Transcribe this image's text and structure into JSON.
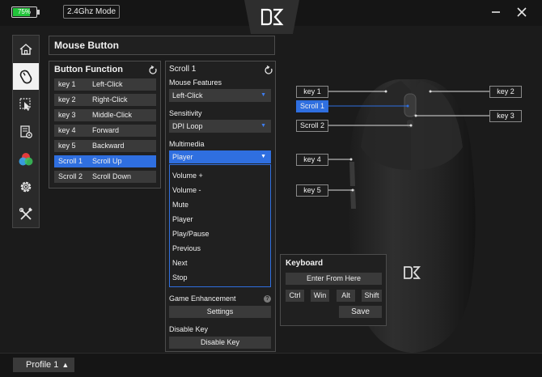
{
  "topbar": {
    "battery_percent": "75%",
    "battery_level": 0.75,
    "battery_color": "#22c43a",
    "connection_mode": "2.4Ghz Mode",
    "logo_icon": "dz-logo-icon",
    "minimize_icon": "minimize-icon",
    "close_icon": "close-icon"
  },
  "sidebar": {
    "items": [
      {
        "icon": "home-icon",
        "active": false
      },
      {
        "icon": "mouse-icon",
        "active": true
      },
      {
        "icon": "pointer-settings-icon",
        "active": false
      },
      {
        "icon": "macro-icon",
        "active": false
      },
      {
        "icon": "rgb-lighting-icon",
        "active": false
      },
      {
        "icon": "gear-icon",
        "active": false
      },
      {
        "icon": "tools-icon",
        "active": false
      }
    ]
  },
  "page_title": "Mouse Button",
  "button_function": {
    "title": "Button Function",
    "rows": [
      {
        "key": "key 1",
        "value": "Left-Click"
      },
      {
        "key": "key 2",
        "value": "Right-Click"
      },
      {
        "key": "key 3",
        "value": "Middle-Click"
      },
      {
        "key": "key 4",
        "value": "Forward"
      },
      {
        "key": "key 5",
        "value": "Backward"
      },
      {
        "key": "Scroll 1",
        "value": "Scroll Up"
      },
      {
        "key": "Scroll 2",
        "value": "Scroll Down"
      }
    ],
    "selected_index": 5
  },
  "scroll_panel": {
    "title": "Scroll 1",
    "mouse_features_label": "Mouse Features",
    "mouse_features_value": "Left-Click",
    "sensitivity_label": "Sensitivity",
    "sensitivity_value": "DPI Loop",
    "multimedia_label": "Multimedia",
    "multimedia_value": "Player",
    "multimedia_options": [
      "Volume +",
      "Volume -",
      "Mute",
      "Player",
      "Play/Pause",
      "Previous",
      "Next",
      "Stop"
    ],
    "game_enhancement_label": "Game Enhancement",
    "settings_button": "Settings",
    "disable_key_label": "Disable Key",
    "disable_key_button": "Disable Key",
    "help_glyph": "?"
  },
  "mouse_keys": {
    "key1": "key 1",
    "key2": "key 2",
    "key3": "key 3",
    "key4": "key 4",
    "key5": "key 5",
    "scroll1": "Scroll 1",
    "scroll2": "Scroll 2"
  },
  "keyboard": {
    "title": "Keyboard",
    "enter_button": "Enter From Here",
    "ctrl": "Ctrl",
    "win": "Win",
    "alt": "Alt",
    "shift": "Shift",
    "save": "Save"
  },
  "footer": {
    "profile": "Profile 1",
    "arrow": "▲"
  },
  "colors": {
    "accent": "#2f6fe0",
    "background": "#1b1b1b",
    "panel": "#202020",
    "control": "#3a3a3a"
  }
}
